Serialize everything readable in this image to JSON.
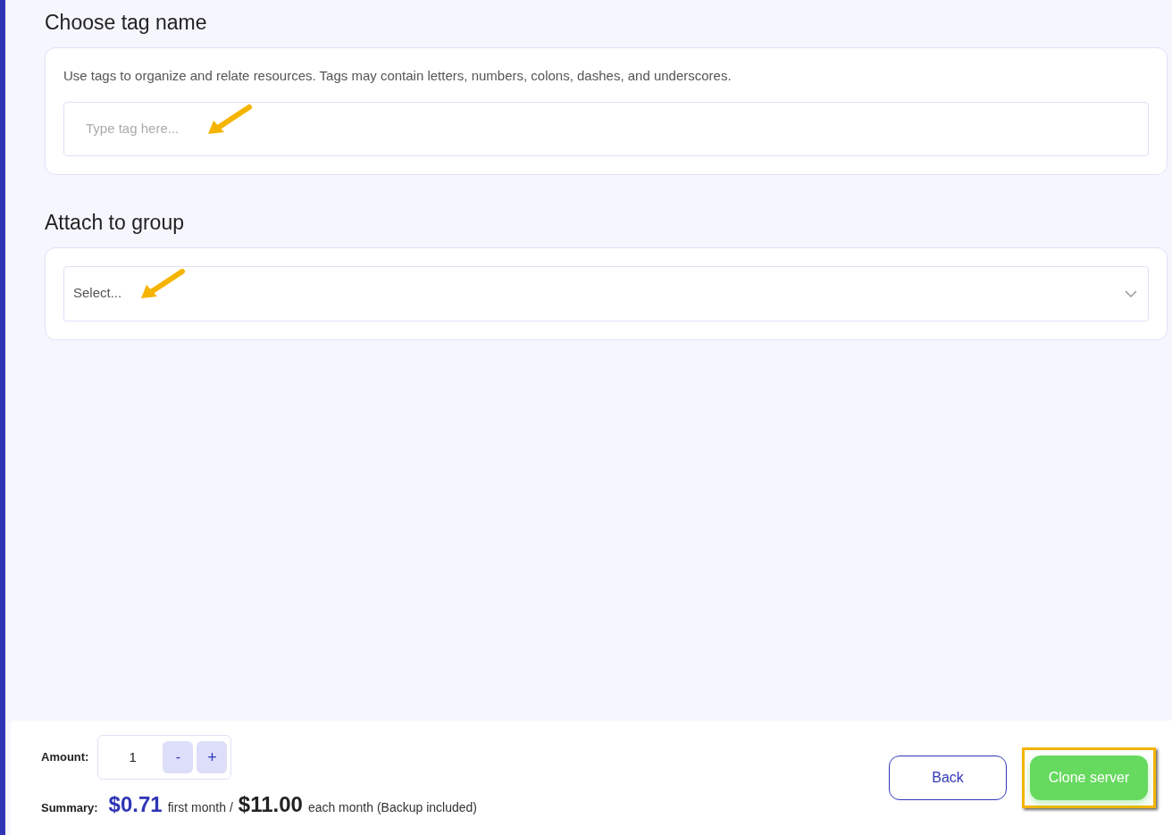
{
  "tag_section": {
    "title": "Choose tag name",
    "description": "Use tags to organize and relate resources. Tags may contain letters, numbers, colons, dashes, and underscores.",
    "field": {
      "placeholder": "Type tag here..."
    }
  },
  "group_section": {
    "title": "Attach to group",
    "select": {
      "placeholder": "Select..."
    }
  },
  "footer": {
    "amount": {
      "label": "Amount:",
      "value": "1",
      "decrement": "-",
      "increment": "+"
    },
    "summary": {
      "label": "Summary:",
      "first_price": "$0.71",
      "first_text": "first month /",
      "monthly_price": "$11.00",
      "monthly_text": "each month (Backup included)"
    },
    "buttons": [
      {
        "kind": "secondary",
        "label": "Back",
        "highlighted": false
      },
      {
        "kind": "primary",
        "label": "Clone server",
        "highlighted": true
      }
    ]
  }
}
